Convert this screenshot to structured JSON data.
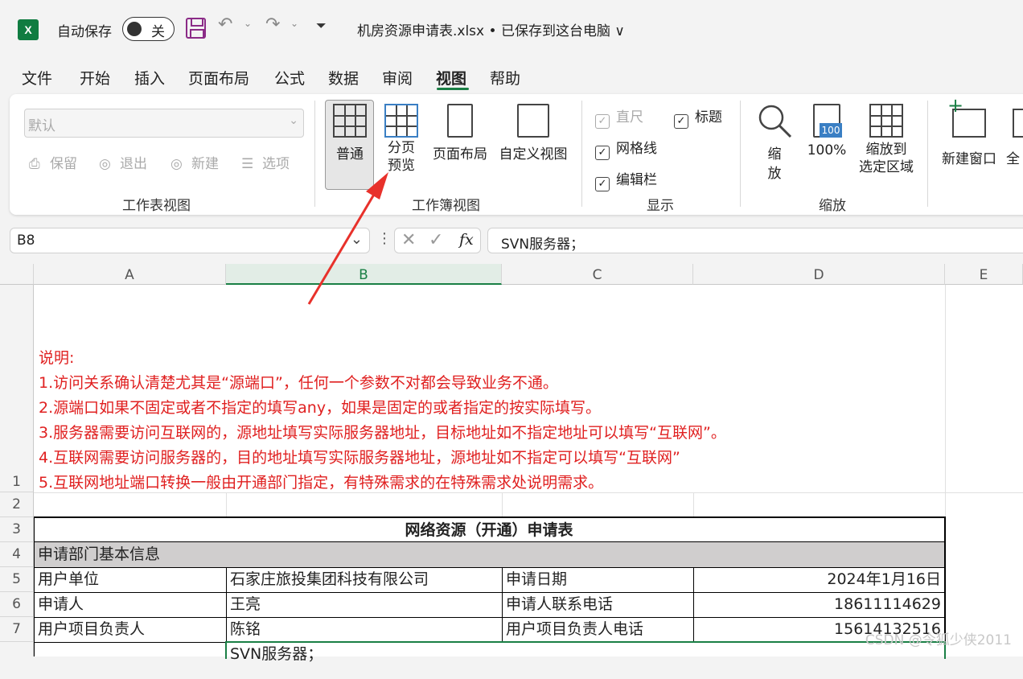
{
  "titlebar": {
    "app_icon": "excel-logo-icon",
    "app_letter": "X",
    "autosave_label": "自动保存",
    "autosave_state": "关",
    "doc_title": "机房资源申请表.xlsx • 已保存到这台电脑 ∨"
  },
  "menu": [
    "文件",
    "开始",
    "插入",
    "页面布局",
    "公式",
    "数据",
    "审阅",
    "视图",
    "帮助"
  ],
  "active_menu": "视图",
  "ribbon": {
    "sheet_view": {
      "select_value": "默认",
      "buttons": [
        "保留",
        "退出",
        "新建",
        "选项"
      ],
      "group_label": "工作表视图"
    },
    "workbook_view": {
      "normal": "普通",
      "page_break_line1": "分页",
      "page_break_line2": "预览",
      "page_layout": "页面布局",
      "custom_view": "自定义视图",
      "group_label": "工作簿视图"
    },
    "show": {
      "ruler": "直尺",
      "gridlines": "网格线",
      "formula_bar": "编辑栏",
      "headings": "标题",
      "group_label": "显示"
    },
    "zoom": {
      "zoom_line1": "缩",
      "zoom_line2": "放",
      "zoom100": "100%",
      "zoom100_badge": "100",
      "zoom_sel_line1": "缩放到",
      "zoom_sel_line2": "选定区域",
      "group_label": "缩放"
    },
    "window": {
      "new_window": "新建窗口",
      "arrange_all": "全"
    }
  },
  "formula_bar": {
    "name_box": "B8",
    "formula": "SVN服务器；",
    "fx": "fx"
  },
  "columns": [
    "A",
    "B",
    "C",
    "D",
    "E"
  ],
  "rows": [
    "1",
    "2",
    "3",
    "4",
    "5",
    "6",
    "7"
  ],
  "notes": [
    "说明:",
    "1.访问关系确认清楚尤其是“源端口”，任何一个参数不对都会导致业务不通。",
    "2.源端口如果不固定或者不指定的填写any，如果是固定的或者指定的按实际填写。",
    "3.服务器需要访问互联网的，源地址填写实际服务器地址，目标地址如不指定地址可以填写“互联网”。",
    "4.互联网需要访问服务器的，目的地址填写实际服务器地址，源地址如不指定可以填写“互联网”",
    "5.互联网地址端口转换一般由开通部门指定，有特殊需求的在特殊需求处说明需求。"
  ],
  "table": {
    "title": "网络资源（开通）申请表",
    "section": "申请部门基本信息",
    "rows": [
      [
        "用户单位",
        "石家庄旅投集团科技有限公司",
        "申请日期",
        "2024年1月16日"
      ],
      [
        "申请人",
        "王亮",
        "申请人联系电话",
        "18611114629"
      ],
      [
        "用户项目负责人",
        "陈铭",
        "用户项目负责人电话",
        "15614132516"
      ]
    ],
    "row8_b": "SVN服务器；"
  },
  "watermark": "CSDN @令狐少侠2011",
  "colors": {
    "excel_green": "#107c41",
    "note_red": "#e02020",
    "arrow_red": "#e8312b",
    "section_gray": "#d0cece"
  }
}
